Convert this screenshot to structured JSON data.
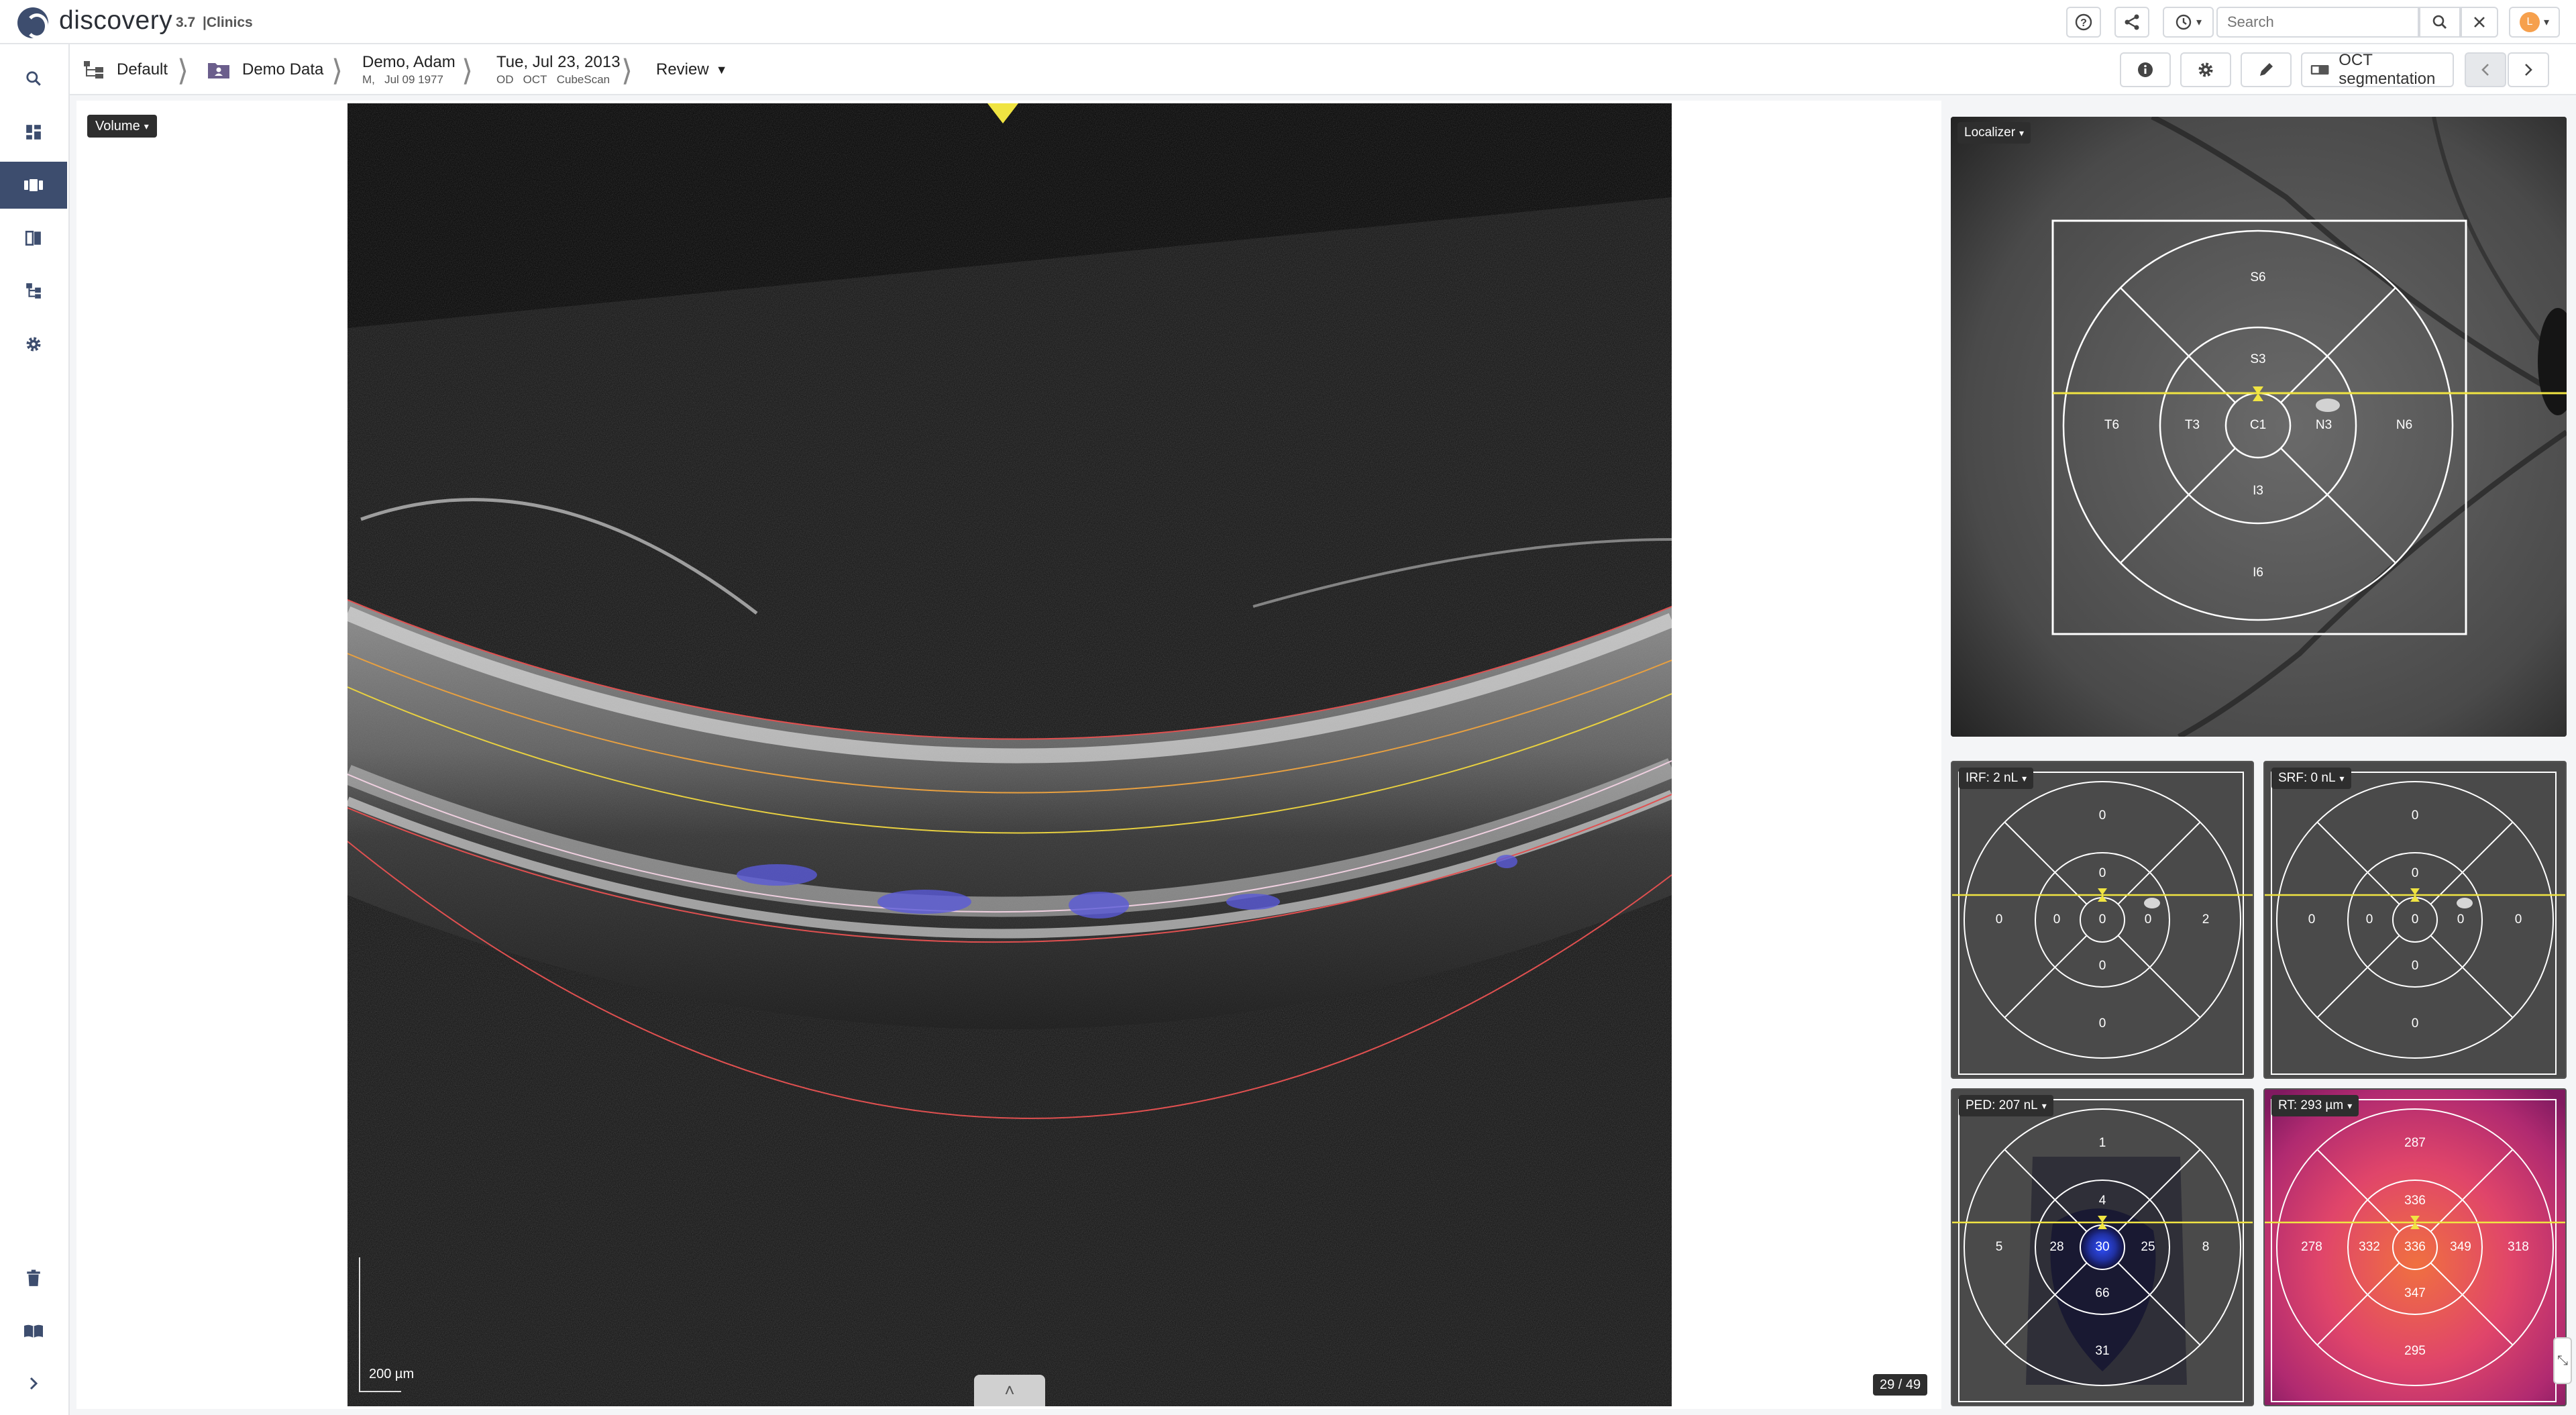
{
  "app": {
    "name": "discovery",
    "version": "3.7",
    "edition": "|Clinics"
  },
  "topbar": {
    "help_icon": "question-circle-icon",
    "share_icon": "share-icon",
    "history_icon": "history-icon",
    "search_placeholder": "Search",
    "user_initial": "L"
  },
  "nav": {
    "items": [
      "search-icon",
      "dashboard-icon",
      "viewer-icon",
      "compare-icon",
      "workflow-icon",
      "settings-icon"
    ],
    "bottom_items": [
      "trash-icon",
      "book-icon",
      "expand-icon"
    ]
  },
  "breadcrumb": {
    "workspace": "Default",
    "project": "Demo Data",
    "patient_name": "Demo, Adam",
    "patient_sex": "M,",
    "patient_dob": "Jul 09 1977",
    "exam_date": "Tue, Jul 23, 2013",
    "exam_eye": "OD",
    "exam_modality": "OCT",
    "exam_protocol": "CubeScan",
    "mode": "Review"
  },
  "toolbar": {
    "segmentation_label": "OCT segmentation"
  },
  "viewer": {
    "volume_label": "Volume",
    "scale_bar": "200 µm",
    "slice_counter": "29 / 49"
  },
  "localizer": {
    "label": "Localizer",
    "sectors": {
      "S6": "S6",
      "S3": "S3",
      "T6": "T6",
      "T3": "T3",
      "C1": "C1",
      "N3": "N3",
      "N6": "N6",
      "I3": "I3",
      "I6": "I6"
    }
  },
  "irf": {
    "label": "IRF: 2 nL",
    "values": {
      "S6": "0",
      "S3": "0",
      "T6": "0",
      "T3": "0",
      "C1": "0",
      "N3": "0",
      "N6": "2",
      "I3": "0",
      "I6": "0"
    }
  },
  "srf": {
    "label": "SRF: 0 nL",
    "values": {
      "S6": "0",
      "S3": "0",
      "T6": "0",
      "T3": "0",
      "C1": "0",
      "N3": "0",
      "N6": "0",
      "I3": "0",
      "I6": "0"
    }
  },
  "ped": {
    "label": "PED: 207 nL",
    "values": {
      "S6": "1",
      "S3": "4",
      "T6": "5",
      "T3": "28",
      "C1": "30",
      "N3": "25",
      "N6": "8",
      "I3": "66",
      "I6": "31"
    }
  },
  "rt": {
    "label": "RT: 293 µm",
    "values": {
      "S6": "287",
      "S3": "336",
      "T6": "278",
      "T3": "332",
      "C1": "336",
      "N3": "349",
      "N6": "318",
      "I3": "347",
      "I6": "295"
    }
  },
  "colors": {
    "brand": "#3d4d6e",
    "scan_line": "#f0e442",
    "irf_fluid": "#5a5ad8",
    "rt_heatmap": "#e0456a"
  }
}
